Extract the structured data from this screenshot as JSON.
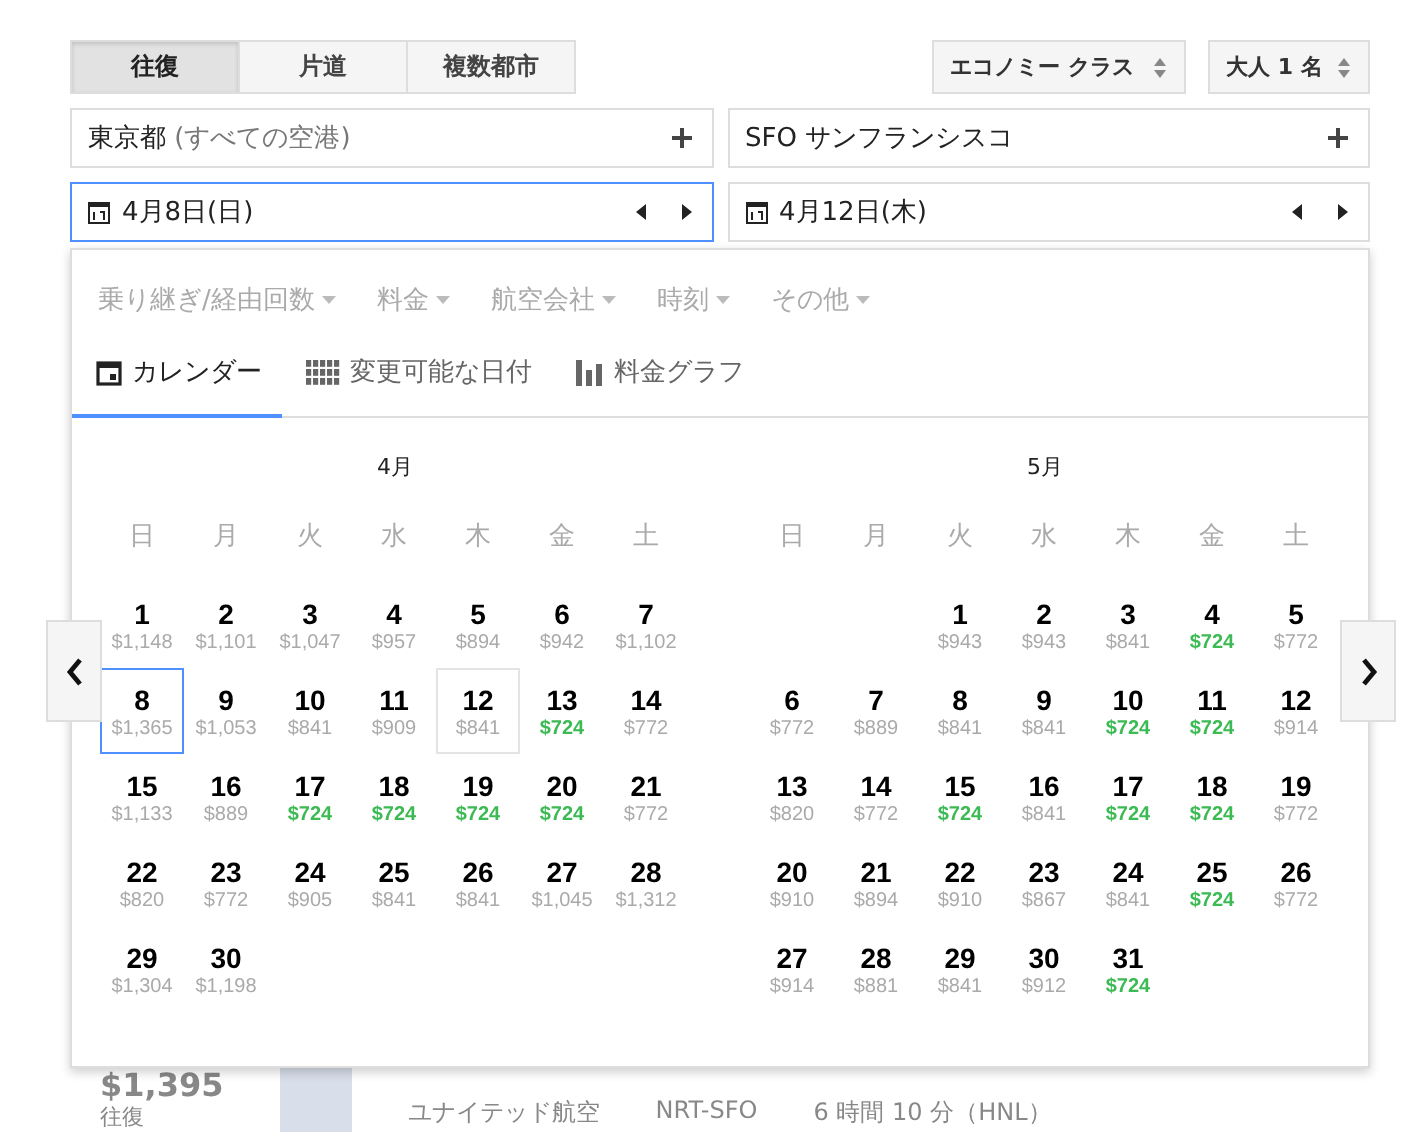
{
  "trip_types": [
    {
      "label": "往復",
      "selected": true
    },
    {
      "label": "片道",
      "selected": false
    },
    {
      "label": "複数都市",
      "selected": false
    }
  ],
  "cabin": "エコノミー クラス",
  "passengers": "大人 1 名",
  "origin": {
    "main": "東京都",
    "sub": " (すべての空港)"
  },
  "destination": {
    "main": "SFO サンフランシスコ"
  },
  "depart_date": "4月8日(日)",
  "return_date": "4月12日(木)",
  "filters": [
    "乗り継ぎ/経由回数",
    "料金",
    "航空会社",
    "時刻",
    "その他"
  ],
  "view_tabs": [
    {
      "label": "カレンダー",
      "kind": "calendar",
      "selected": true
    },
    {
      "label": "変更可能な日付",
      "kind": "grid",
      "selected": false
    },
    {
      "label": "料金グラフ",
      "kind": "chart",
      "selected": false
    }
  ],
  "months": [
    {
      "title": "4月",
      "weekdays": [
        "日",
        "月",
        "火",
        "水",
        "木",
        "金",
        "土"
      ],
      "days": [
        {
          "d": "1",
          "price": "$1,148",
          "cheap": false,
          "kind": "normal"
        },
        {
          "d": "2",
          "price": "$1,101",
          "cheap": false,
          "kind": "normal"
        },
        {
          "d": "3",
          "price": "$1,047",
          "cheap": false,
          "kind": "normal"
        },
        {
          "d": "4",
          "price": "$957",
          "cheap": false,
          "kind": "normal"
        },
        {
          "d": "5",
          "price": "$894",
          "cheap": false,
          "kind": "normal"
        },
        {
          "d": "6",
          "price": "$942",
          "cheap": false,
          "kind": "normal"
        },
        {
          "d": "7",
          "price": "$1,102",
          "cheap": false,
          "kind": "normal"
        },
        {
          "d": "8",
          "price": "$1,365",
          "cheap": false,
          "kind": "depart"
        },
        {
          "d": "9",
          "price": "$1,053",
          "cheap": false,
          "kind": "normal"
        },
        {
          "d": "10",
          "price": "$841",
          "cheap": false,
          "kind": "normal"
        },
        {
          "d": "11",
          "price": "$909",
          "cheap": false,
          "kind": "normal"
        },
        {
          "d": "12",
          "price": "$841",
          "cheap": false,
          "kind": "return"
        },
        {
          "d": "13",
          "price": "$724",
          "cheap": true,
          "kind": "normal"
        },
        {
          "d": "14",
          "price": "$772",
          "cheap": false,
          "kind": "normal"
        },
        {
          "d": "15",
          "price": "$1,133",
          "cheap": false,
          "kind": "normal"
        },
        {
          "d": "16",
          "price": "$889",
          "cheap": false,
          "kind": "normal"
        },
        {
          "d": "17",
          "price": "$724",
          "cheap": true,
          "kind": "normal"
        },
        {
          "d": "18",
          "price": "$724",
          "cheap": true,
          "kind": "normal"
        },
        {
          "d": "19",
          "price": "$724",
          "cheap": true,
          "kind": "normal"
        },
        {
          "d": "20",
          "price": "$724",
          "cheap": true,
          "kind": "normal"
        },
        {
          "d": "21",
          "price": "$772",
          "cheap": false,
          "kind": "normal"
        },
        {
          "d": "22",
          "price": "$820",
          "cheap": false,
          "kind": "normal"
        },
        {
          "d": "23",
          "price": "$772",
          "cheap": false,
          "kind": "normal"
        },
        {
          "d": "24",
          "price": "$905",
          "cheap": false,
          "kind": "normal"
        },
        {
          "d": "25",
          "price": "$841",
          "cheap": false,
          "kind": "normal"
        },
        {
          "d": "26",
          "price": "$841",
          "cheap": false,
          "kind": "normal"
        },
        {
          "d": "27",
          "price": "$1,045",
          "cheap": false,
          "kind": "normal"
        },
        {
          "d": "28",
          "price": "$1,312",
          "cheap": false,
          "kind": "normal"
        },
        {
          "d": "29",
          "price": "$1,304",
          "cheap": false,
          "kind": "normal"
        },
        {
          "d": "30",
          "price": "$1,198",
          "cheap": false,
          "kind": "normal"
        }
      ]
    },
    {
      "title": "5月",
      "weekdays": [
        "日",
        "月",
        "火",
        "水",
        "木",
        "金",
        "土"
      ],
      "days": [
        {
          "kind": "blank"
        },
        {
          "kind": "blank"
        },
        {
          "d": "1",
          "price": "$943",
          "cheap": false,
          "kind": "normal"
        },
        {
          "d": "2",
          "price": "$943",
          "cheap": false,
          "kind": "normal"
        },
        {
          "d": "3",
          "price": "$841",
          "cheap": false,
          "kind": "normal"
        },
        {
          "d": "4",
          "price": "$724",
          "cheap": true,
          "kind": "normal"
        },
        {
          "d": "5",
          "price": "$772",
          "cheap": false,
          "kind": "normal"
        },
        {
          "d": "6",
          "price": "$772",
          "cheap": false,
          "kind": "normal"
        },
        {
          "d": "7",
          "price": "$889",
          "cheap": false,
          "kind": "normal"
        },
        {
          "d": "8",
          "price": "$841",
          "cheap": false,
          "kind": "normal"
        },
        {
          "d": "9",
          "price": "$841",
          "cheap": false,
          "kind": "normal"
        },
        {
          "d": "10",
          "price": "$724",
          "cheap": true,
          "kind": "normal"
        },
        {
          "d": "11",
          "price": "$724",
          "cheap": true,
          "kind": "normal"
        },
        {
          "d": "12",
          "price": "$914",
          "cheap": false,
          "kind": "normal"
        },
        {
          "d": "13",
          "price": "$820",
          "cheap": false,
          "kind": "normal"
        },
        {
          "d": "14",
          "price": "$772",
          "cheap": false,
          "kind": "normal"
        },
        {
          "d": "15",
          "price": "$724",
          "cheap": true,
          "kind": "normal"
        },
        {
          "d": "16",
          "price": "$841",
          "cheap": false,
          "kind": "normal"
        },
        {
          "d": "17",
          "price": "$724",
          "cheap": true,
          "kind": "normal"
        },
        {
          "d": "18",
          "price": "$724",
          "cheap": true,
          "kind": "normal"
        },
        {
          "d": "19",
          "price": "$772",
          "cheap": false,
          "kind": "normal"
        },
        {
          "d": "20",
          "price": "$910",
          "cheap": false,
          "kind": "normal"
        },
        {
          "d": "21",
          "price": "$894",
          "cheap": false,
          "kind": "normal"
        },
        {
          "d": "22",
          "price": "$910",
          "cheap": false,
          "kind": "normal"
        },
        {
          "d": "23",
          "price": "$867",
          "cheap": false,
          "kind": "normal"
        },
        {
          "d": "24",
          "price": "$841",
          "cheap": false,
          "kind": "normal"
        },
        {
          "d": "25",
          "price": "$724",
          "cheap": true,
          "kind": "normal"
        },
        {
          "d": "26",
          "price": "$772",
          "cheap": false,
          "kind": "normal"
        },
        {
          "d": "27",
          "price": "$914",
          "cheap": false,
          "kind": "normal"
        },
        {
          "d": "28",
          "price": "$881",
          "cheap": false,
          "kind": "normal"
        },
        {
          "d": "29",
          "price": "$841",
          "cheap": false,
          "kind": "normal"
        },
        {
          "d": "30",
          "price": "$912",
          "cheap": false,
          "kind": "normal"
        },
        {
          "d": "31",
          "price": "$724",
          "cheap": true,
          "kind": "normal"
        }
      ]
    }
  ],
  "result_behind": {
    "price": "$1,395",
    "trip": "往復",
    "airline": "ユナイテッド航空",
    "route": "NRT-SFO",
    "layover": "6 時間 10 分（HNL）"
  }
}
